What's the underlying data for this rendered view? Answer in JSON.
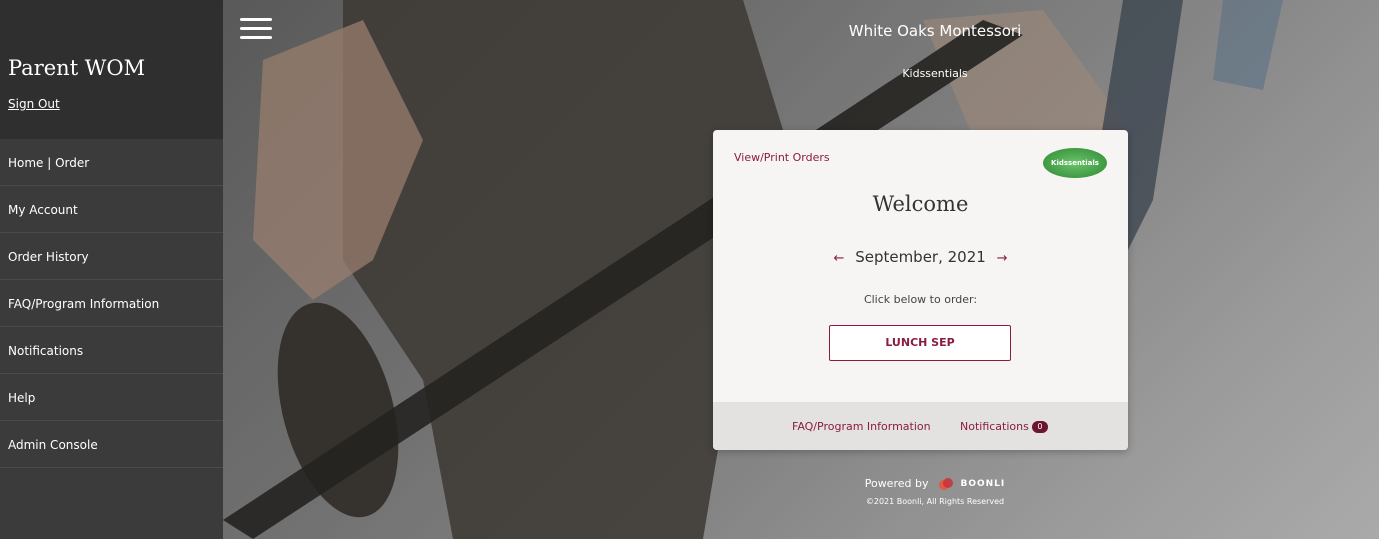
{
  "sidebar": {
    "user_name": "Parent WOM",
    "sign_out": "Sign Out",
    "items": [
      {
        "label": "Home | Order"
      },
      {
        "label": "My Account"
      },
      {
        "label": "Order History"
      },
      {
        "label": "FAQ/Program Information"
      },
      {
        "label": "Notifications"
      },
      {
        "label": "Help"
      },
      {
        "label": "Admin Console"
      }
    ]
  },
  "header": {
    "menu_icon": "hamburger-menu-icon",
    "school_name": "White Oaks Montessori",
    "vendor_name": "Kidssentials"
  },
  "card": {
    "view_print_label": "View/Print Orders",
    "logo_text": "Kidssentials",
    "welcome": "Welcome",
    "prev_icon": "arrow-left-icon",
    "month": "September, 2021",
    "next_icon": "arrow-right-icon",
    "instruction": "Click below to order:",
    "order_button": "LUNCH SEP",
    "footer": {
      "faq_label": "FAQ/Program Information",
      "notifications_label": "Notifications",
      "notifications_count": "0"
    }
  },
  "footer": {
    "powered_by": "Powered by",
    "brand": "BOONLI",
    "copyright": "©2021 Boonli, All Rights Reserved"
  },
  "colors": {
    "sidebar_bg": "#3b3b3b",
    "sidebar_head_bg": "#2f2f2f",
    "accent": "#8a1d3f",
    "card_bg": "#f7f5f3",
    "logo_green": "#3f9a43"
  }
}
